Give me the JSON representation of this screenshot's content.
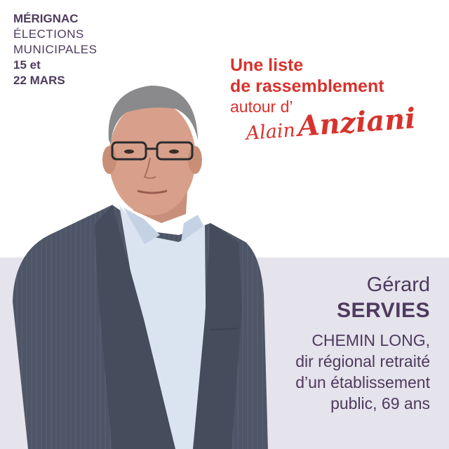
{
  "election": {
    "city": "MÉRIGNAC",
    "line2": "ÉLECTIONS",
    "line3": "MUNICIPALES",
    "date1": "15 et",
    "date2": "22 MARS"
  },
  "headline": {
    "line1": "Une liste",
    "line2": "de rassemblement",
    "line3": "autour d’",
    "sig_first": "Alain",
    "sig_last": "Anziani"
  },
  "candidate": {
    "first_name": "Gérard",
    "last_name": "SERVIES",
    "desc1": "CHEMIN LONG,",
    "desc2": "dir régional retraité",
    "desc3": "d’un établissement",
    "desc4": "public, 69 ans"
  },
  "colors": {
    "purple": "#4e3a5e",
    "red": "#d8322c",
    "band": "#e5e3eb"
  }
}
